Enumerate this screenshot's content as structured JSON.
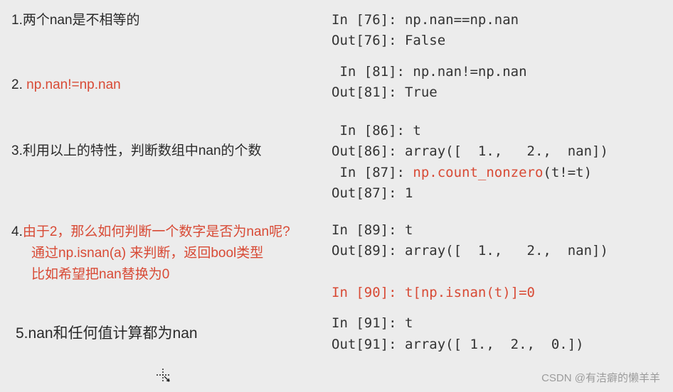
{
  "rows": {
    "r1": {
      "left": "1.两个nan是不相等的",
      "code_in": "In [76]: np.nan==np.nan",
      "code_out": "Out[76]: False"
    },
    "r2": {
      "left_prefix": "2. ",
      "left_red": "np.nan!=np.nan",
      "code_in": " In [81]: np.nan!=np.nan",
      "code_out": "Out[81]: True"
    },
    "r3": {
      "left": "3.利用以上的特性，判断数组中nan的个数",
      "code_in1": " In [86]: t",
      "code_out1": "Out[86]: array([  1.,   2.,  nan])",
      "code_in2_a": " In [87]: ",
      "code_in2_red": "np.count_nonzero",
      "code_in2_b": "(t!=t)",
      "code_out2": "Out[87]: 1"
    },
    "r4": {
      "l1_prefix": "4.",
      "l1_red": "由于2，那么如何判断一个数字是否为nan呢?",
      "l2_red": "通过np.isnan(a) 来判断，返回bool类型",
      "l3_red": "比如希望把nan替换为0",
      "code_in1": "In [89]: t",
      "code_out1": "Out[89]: array([  1.,   2.,  nan])",
      "code_in2_red": "In [90]: t[np.isnan(t)]=0"
    },
    "r5": {
      "left": "5.nan和任何值计算都为nan",
      "code_in": "In [91]: t",
      "code_out": "Out[91]: array([ 1.,  2.,  0.])"
    }
  },
  "watermark": "CSDN @有洁癖的懒羊羊",
  "cursor": "✥ ▸"
}
